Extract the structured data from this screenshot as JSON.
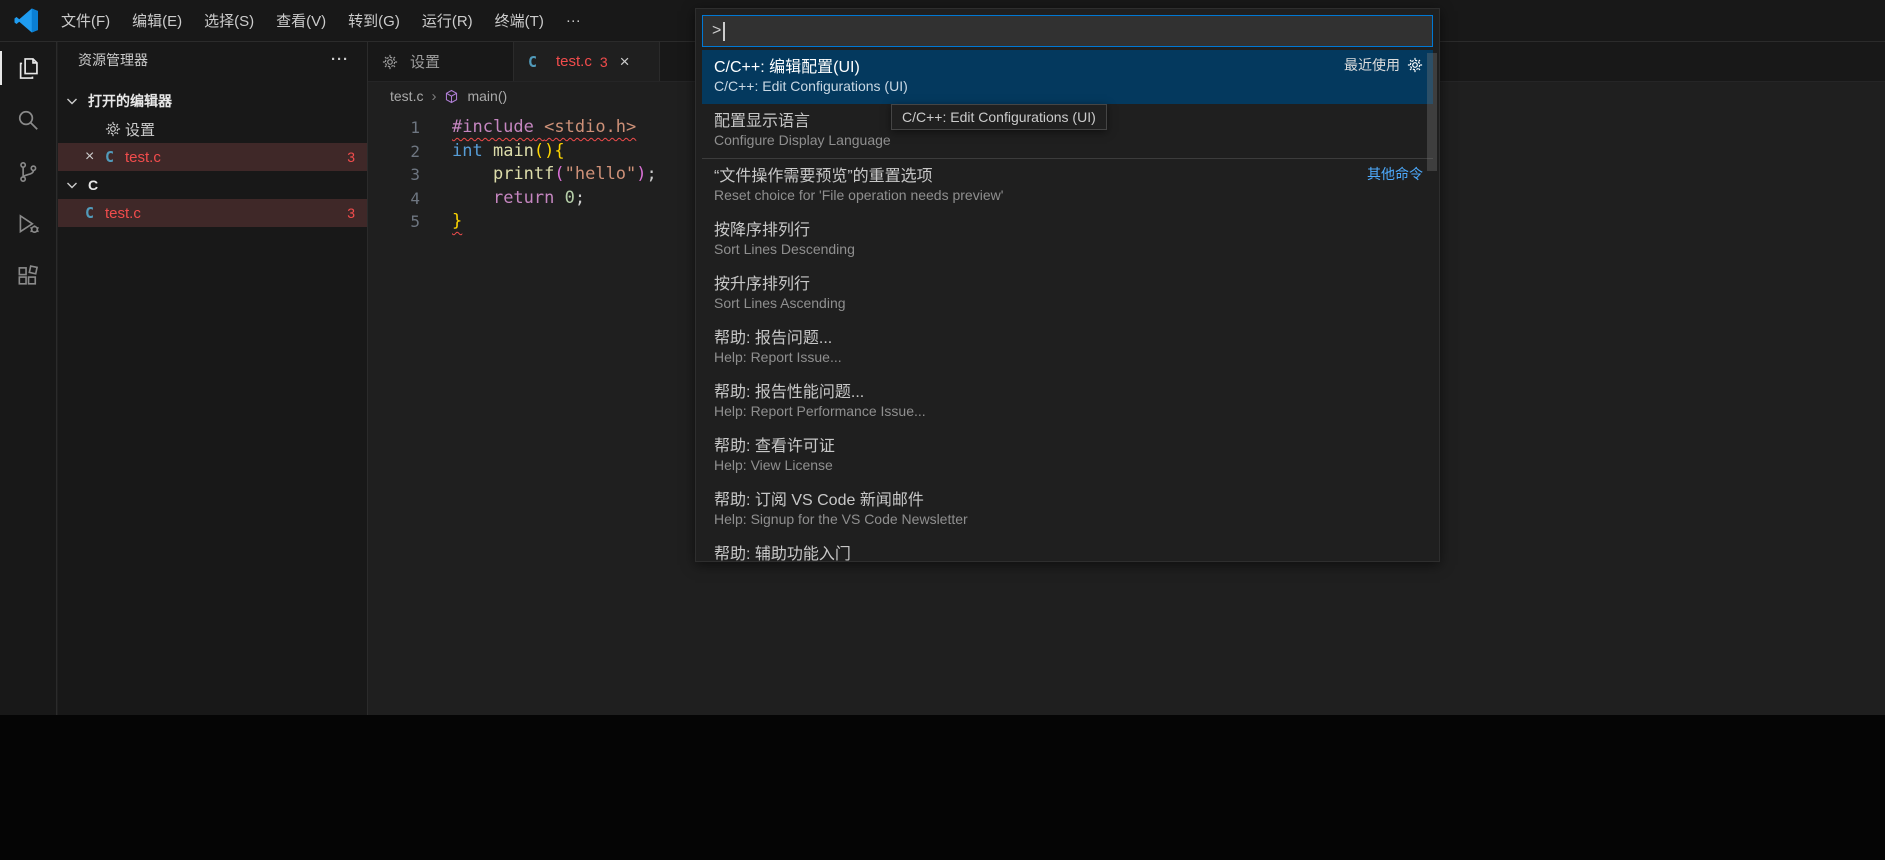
{
  "colors": {
    "accent": "#0078d4",
    "selection_blue": "#04395e",
    "error_red": "#f14c4c",
    "link_blue": "#4daafc",
    "titlebar_bg": "#181818",
    "editor_bg": "#1f1f1f"
  },
  "menu_bar": {
    "items": [
      {
        "label": "文件(F)"
      },
      {
        "label": "编辑(E)"
      },
      {
        "label": "选择(S)"
      },
      {
        "label": "查看(V)"
      },
      {
        "label": "转到(G)"
      },
      {
        "label": "运行(R)"
      },
      {
        "label": "终端(T)"
      },
      {
        "label": "···"
      }
    ]
  },
  "activity_bar": {
    "items": [
      {
        "name": "explorer",
        "active": true
      },
      {
        "name": "search",
        "active": false
      },
      {
        "name": "source-control",
        "active": false
      },
      {
        "name": "run-debug",
        "active": false
      },
      {
        "name": "extensions",
        "active": false
      }
    ]
  },
  "sidebar": {
    "title": "资源管理器",
    "more_actions": "···",
    "open_editors": {
      "label": "打开的编辑器",
      "items": [
        {
          "icon": "gear",
          "label": "设置",
          "error": false,
          "selected": false,
          "closable": false,
          "badge": ""
        },
        {
          "icon": "c",
          "label": "test.c",
          "error": true,
          "selected": true,
          "closable": true,
          "badge": "3"
        }
      ]
    },
    "folder": {
      "label": "C",
      "items": [
        {
          "icon": "c",
          "label": "test.c",
          "error": true,
          "selected": true,
          "closable": false,
          "badge": "3"
        }
      ]
    }
  },
  "editor": {
    "tabs": [
      {
        "icon": "gear",
        "label": "设置",
        "active": false,
        "error": false,
        "badge": "",
        "close": ""
      },
      {
        "icon": "c",
        "label": "test.c",
        "active": true,
        "error": true,
        "badge": "3",
        "close": "×"
      }
    ],
    "breadcrumb": {
      "file": "test.c",
      "separator": "›",
      "symbol": "main()"
    },
    "code_lines": [
      {
        "n": "1",
        "squiggle": true,
        "tokens": [
          {
            "t": "#include",
            "c": "mag"
          },
          {
            "t": " ",
            "c": "fg"
          },
          {
            "t": "<stdio.h>",
            "c": "str"
          }
        ]
      },
      {
        "n": "2",
        "squiggle": false,
        "tokens": [
          {
            "t": "int",
            "c": "kw"
          },
          {
            "t": " ",
            "c": "fg"
          },
          {
            "t": "main",
            "c": "fn"
          },
          {
            "t": "()",
            "c": "b1"
          },
          {
            "t": "{",
            "c": "b1"
          }
        ]
      },
      {
        "n": "3",
        "squiggle": false,
        "tokens": [
          {
            "t": "    ",
            "c": "fg"
          },
          {
            "t": "printf",
            "c": "fn"
          },
          {
            "t": "(",
            "c": "b2"
          },
          {
            "t": "\"hello\"",
            "c": "str"
          },
          {
            "t": ")",
            "c": "b2"
          },
          {
            "t": ";",
            "c": "fg"
          }
        ]
      },
      {
        "n": "4",
        "squiggle": false,
        "tokens": [
          {
            "t": "    ",
            "c": "fg"
          },
          {
            "t": "return",
            "c": "mag"
          },
          {
            "t": " ",
            "c": "fg"
          },
          {
            "t": "0",
            "c": "num"
          },
          {
            "t": ";",
            "c": "fg"
          }
        ]
      },
      {
        "n": "5",
        "squiggle": true,
        "tokens": [
          {
            "t": "}",
            "c": "b1"
          }
        ]
      }
    ]
  },
  "command_palette": {
    "input_value": ">",
    "items": [
      {
        "title": "C/C++: 编辑配置(UI)",
        "subtitle": "C/C++: Edit Configurations (UI)",
        "selected": true,
        "meta": "最近使用",
        "meta_type": "recent",
        "meta_gear": true,
        "separator_top": false
      },
      {
        "title": "配置显示语言",
        "subtitle": "Configure Display Language",
        "selected": false,
        "meta": "",
        "meta_type": "",
        "meta_gear": false,
        "separator_top": false
      },
      {
        "title": "“文件操作需要预览”的重置选项",
        "subtitle": "Reset choice for 'File operation needs preview'",
        "selected": false,
        "meta": "其他命令",
        "meta_type": "link",
        "meta_gear": false,
        "separator_top": true
      },
      {
        "title": "按降序排列行",
        "subtitle": "Sort Lines Descending",
        "selected": false,
        "meta": "",
        "meta_type": "",
        "meta_gear": false,
        "separator_top": false
      },
      {
        "title": "按升序排列行",
        "subtitle": "Sort Lines Ascending",
        "selected": false,
        "meta": "",
        "meta_type": "",
        "meta_gear": false,
        "separator_top": false
      },
      {
        "title": "帮助: 报告问题...",
        "subtitle": "Help: Report Issue...",
        "selected": false,
        "meta": "",
        "meta_type": "",
        "meta_gear": false,
        "separator_top": false
      },
      {
        "title": "帮助: 报告性能问题...",
        "subtitle": "Help: Report Performance Issue...",
        "selected": false,
        "meta": "",
        "meta_type": "",
        "meta_gear": false,
        "separator_top": false
      },
      {
        "title": "帮助: 查看许可证",
        "subtitle": "Help: View License",
        "selected": false,
        "meta": "",
        "meta_type": "",
        "meta_gear": false,
        "separator_top": false
      },
      {
        "title": "帮助: 订阅 VS Code 新闻邮件",
        "subtitle": "Help: Signup for the VS Code Newsletter",
        "selected": false,
        "meta": "",
        "meta_type": "",
        "meta_gear": false,
        "separator_top": false
      },
      {
        "title": "帮助: 辅助功能入门",
        "subtitle": "",
        "selected": false,
        "meta": "",
        "meta_type": "",
        "meta_gear": false,
        "separator_top": false
      }
    ]
  },
  "tooltip": {
    "text": "C/C++: Edit Configurations (UI)"
  }
}
